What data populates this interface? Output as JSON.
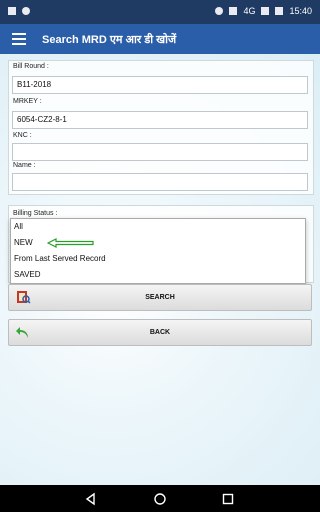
{
  "status_bar": {
    "network": "4G",
    "time": "15:40",
    "icons": [
      "notification-icon",
      "bug-icon",
      "location-icon",
      "wifi-icon",
      "signal-icon",
      "battery-icon"
    ]
  },
  "toolbar": {
    "menu_icon": "hamburger-icon",
    "title": "Search MRD एम आर डी खोजें"
  },
  "form": {
    "bill_round": {
      "label": "Bill Round :",
      "value": "B11-2018"
    },
    "mrkey": {
      "label": "MRKEY :",
      "value": "6054-CZ2-8-1"
    },
    "knc": {
      "label": "KNC :",
      "value": ""
    },
    "name": {
      "label": "Name :",
      "value": ""
    },
    "billing_status": {
      "label": "Billing Status :"
    }
  },
  "dropdown": {
    "options": [
      "All",
      "NEW",
      "From Last Served Record",
      "SAVED"
    ],
    "highlight_color": "#1fa01f"
  },
  "buttons": {
    "search_label": "SEARCH",
    "back_label": "BACK"
  },
  "colors": {
    "status_bar": "#1f3b63",
    "toolbar": "#2b5ea9",
    "arrow": "#2a9d2a"
  },
  "nav": {
    "back_icon": "back-triangle-icon",
    "home_icon": "home-circle-icon",
    "recents_icon": "recents-square-icon"
  }
}
